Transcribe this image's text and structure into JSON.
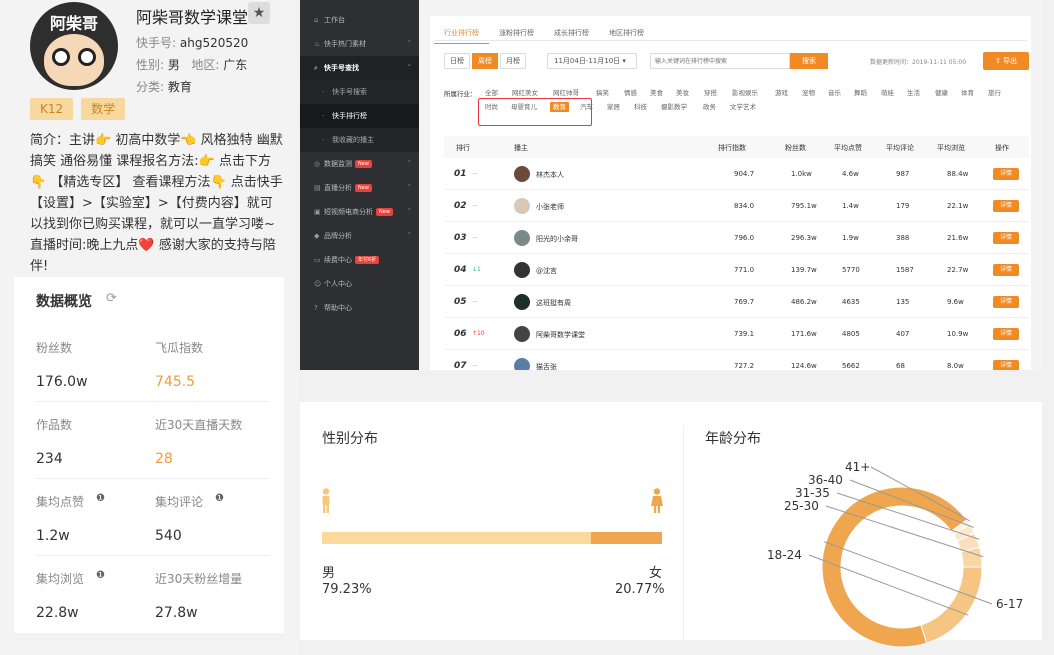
{
  "profile": {
    "avatar_text": "阿柴哥",
    "name": "阿柴哥数学课堂",
    "id_label": "快手号:",
    "id_value": "ahg520520",
    "gender_label": "性别:",
    "gender_value": "男",
    "region_label": "地区:",
    "region_value": "广东",
    "category_label": "分类:",
    "category_value": "教育",
    "tags": [
      "K12",
      "数学"
    ],
    "bio": "简介：主讲👉 初高中数学👈 风格独特 幽默搞笑 通俗易懂 课程报名方法:👉 点击下方👇 【精选专区】 查看课程方法👇 点击快手【设置】>【实验室】>【付费内容】就可以找到你已购买课程，就可以一直学习喽~ 直播时间:晚上九点❤️ 感谢大家的支持与陪伴!"
  },
  "overview": {
    "title": "数据概览",
    "stats": [
      {
        "label": "粉丝数",
        "value": "176.0w",
        "highlight": false
      },
      {
        "label": "飞瓜指数",
        "value": "745.5",
        "highlight": true
      },
      {
        "label": "作品数",
        "value": "234",
        "highlight": false
      },
      {
        "label": "近30天直播天数",
        "value": "28",
        "highlight": true
      },
      {
        "label": "集均点赞",
        "value": "1.2w",
        "highlight": false
      },
      {
        "label": "集均评论",
        "value": "540",
        "highlight": false
      },
      {
        "label": "集均浏览",
        "value": "22.8w",
        "highlight": false
      },
      {
        "label": "近30天粉丝增量",
        "value": "27.8w",
        "highlight": false
      }
    ]
  },
  "sidebar": {
    "items": [
      {
        "label": "工作台",
        "icon": "home-icon"
      },
      {
        "label": "快手热门素材",
        "icon": "fire-icon"
      },
      {
        "label": "快手号查找",
        "icon": "search-icon"
      },
      {
        "label": "快手号搜索",
        "icon": ""
      },
      {
        "label": "快手排行榜",
        "icon": ""
      },
      {
        "label": "我收藏的播主",
        "icon": ""
      },
      {
        "label": "数据监测",
        "icon": "monitor-icon",
        "badge": "New"
      },
      {
        "label": "直播分析",
        "icon": "chart-icon",
        "badge": "New"
      },
      {
        "label": "短视频电商分析",
        "icon": "cart-icon",
        "badge": "New"
      },
      {
        "label": "品牌分析",
        "icon": "diamond-icon"
      },
      {
        "label": "续费中心",
        "icon": "card-icon",
        "badge": "年付6折"
      },
      {
        "label": "个人中心",
        "icon": "user-icon"
      },
      {
        "label": "帮助中心",
        "icon": "help-icon"
      }
    ]
  },
  "ranking": {
    "tabs": [
      "行业排行榜",
      "涨粉排行榜",
      "成长排行榜",
      "地区排行榜"
    ],
    "periods": [
      "日榜",
      "周榜",
      "月榜"
    ],
    "date_range": "11月04日-11月10日",
    "search_placeholder": "输入关键词在排行榜中搜索",
    "search_label": "搜索",
    "update_time": "数据更新时间：2019-11-11 05:00",
    "export_label": "导出",
    "industry_label": "所属行业：",
    "industries_row1": [
      "全部",
      "网红美女",
      "网红帅哥",
      "搞笑",
      "情感",
      "美食",
      "美妆",
      "穿搭",
      "影视娱乐",
      "游戏",
      "宠物",
      "音乐",
      "舞蹈",
      "萌娃",
      "生活",
      "健康",
      "体育",
      "旅行"
    ],
    "industries_row2": [
      "时尚",
      "母婴育儿",
      "教育",
      "汽车",
      "家居",
      "科技",
      "摄影教学",
      "政务",
      "文学艺术"
    ],
    "active_industry": "教育",
    "headers": [
      "排行",
      "播主",
      "排行指数",
      "粉丝数",
      "平均点赞",
      "平均评论",
      "平均浏览",
      "操作"
    ],
    "detail_label": "详情",
    "rows": [
      {
        "rank": "01",
        "change": "—",
        "host": "林杰本人",
        "index": "904.7",
        "fans": "1.0kw",
        "likes": "4.6w",
        "comments": "987",
        "views": "88.4w"
      },
      {
        "rank": "02",
        "change": "—",
        "host": "小张老师",
        "index": "834.0",
        "fans": "795.1w",
        "likes": "1.4w",
        "comments": "179",
        "views": "22.1w"
      },
      {
        "rank": "03",
        "change": "—",
        "host": "阳光的小余哥",
        "index": "796.0",
        "fans": "296.3w",
        "likes": "1.9w",
        "comments": "388",
        "views": "21.6w"
      },
      {
        "rank": "04",
        "change": "↓1",
        "host": "@沈言",
        "index": "771.0",
        "fans": "139.7w",
        "likes": "5770",
        "comments": "1587",
        "views": "22.7w"
      },
      {
        "rank": "05",
        "change": "—",
        "host": "这班挺有周",
        "index": "769.7",
        "fans": "486.2w",
        "likes": "4635",
        "comments": "135",
        "views": "9.6w"
      },
      {
        "rank": "06",
        "change": "↑10",
        "host": "阿柴哥数学课堂",
        "index": "739.1",
        "fans": "171.6w",
        "likes": "4805",
        "comments": "407",
        "views": "10.9w"
      },
      {
        "rank": "07",
        "change": "—",
        "host": "猫舌张",
        "index": "727.2",
        "fans": "124.6w",
        "likes": "5662",
        "comments": "68",
        "views": "8.0w"
      }
    ]
  },
  "gender": {
    "title": "性别分布",
    "male_label": "男",
    "male_value": "79.23%",
    "female_label": "女",
    "female_value": "20.77%",
    "female_fraction": 0.2077,
    "colors": {
      "male": "#fbd99b",
      "female": "#f0a64f"
    }
  },
  "age": {
    "title": "年龄分布"
  },
  "chart_data": {
    "type": "pie",
    "categories": [
      "6-17",
      "18-24",
      "25-30",
      "31-35",
      "36-40",
      "41+"
    ],
    "values": [
      70,
      20,
      4,
      3,
      2,
      1
    ],
    "colors": [
      "#f0a64f",
      "#f6c584",
      "#f9d6a4",
      "#fbe1bb",
      "#fce9cd",
      "#fdf1de"
    ]
  },
  "colors": {
    "accent": "#f08a24"
  }
}
